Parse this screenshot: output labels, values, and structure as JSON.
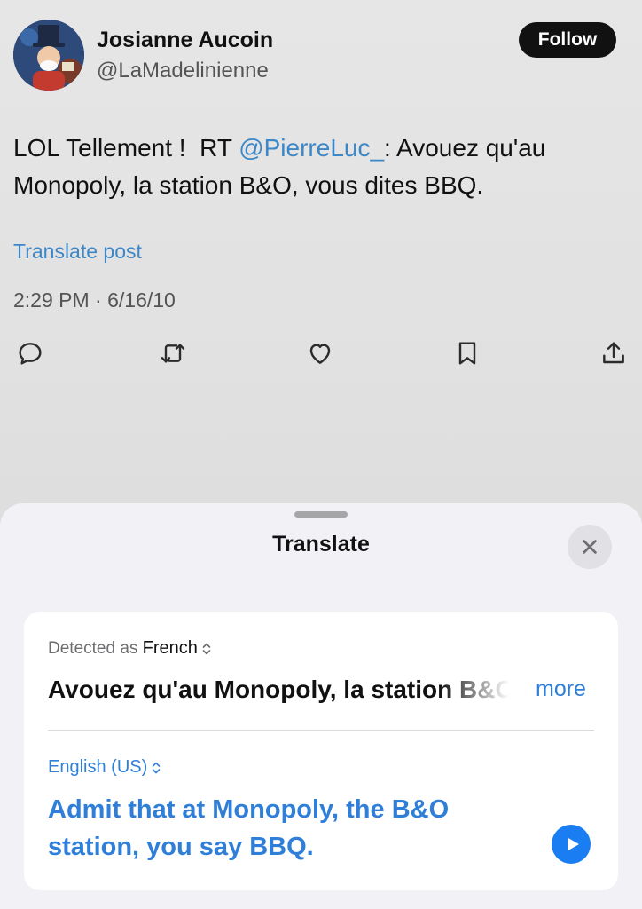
{
  "tweet": {
    "author_name": "Josianne Aucoin",
    "author_handle": "@LaMadelinienne",
    "follow_label": "Follow",
    "text_before": "LOL Tellement !  RT ",
    "mention": "@PierreLuc_",
    "text_after": ": Avouez qu'au Monopoly, la station B&O, vous dites BBQ.",
    "translate_link": "Translate post",
    "timestamp": "2:29 PM · 6/16/10",
    "actions": [
      "reply-icon",
      "retweet-icon",
      "like-icon",
      "bookmark-icon",
      "share-icon"
    ]
  },
  "translate_sheet": {
    "title": "Translate",
    "detected_prefix": "Detected as ",
    "detected_language": "French",
    "source_text": "Avouez qu'au Monopoly, la station B&O, vous dites BBQ.",
    "more_label": "more",
    "target_language": "English (US)",
    "translated_text": "Admit that at Monopoly, the B&O station, you say BBQ."
  },
  "colors": {
    "link": "#3b87c8",
    "accent": "#2f7fd9",
    "play": "#1a7ef2",
    "follow_bg": "#111111"
  }
}
